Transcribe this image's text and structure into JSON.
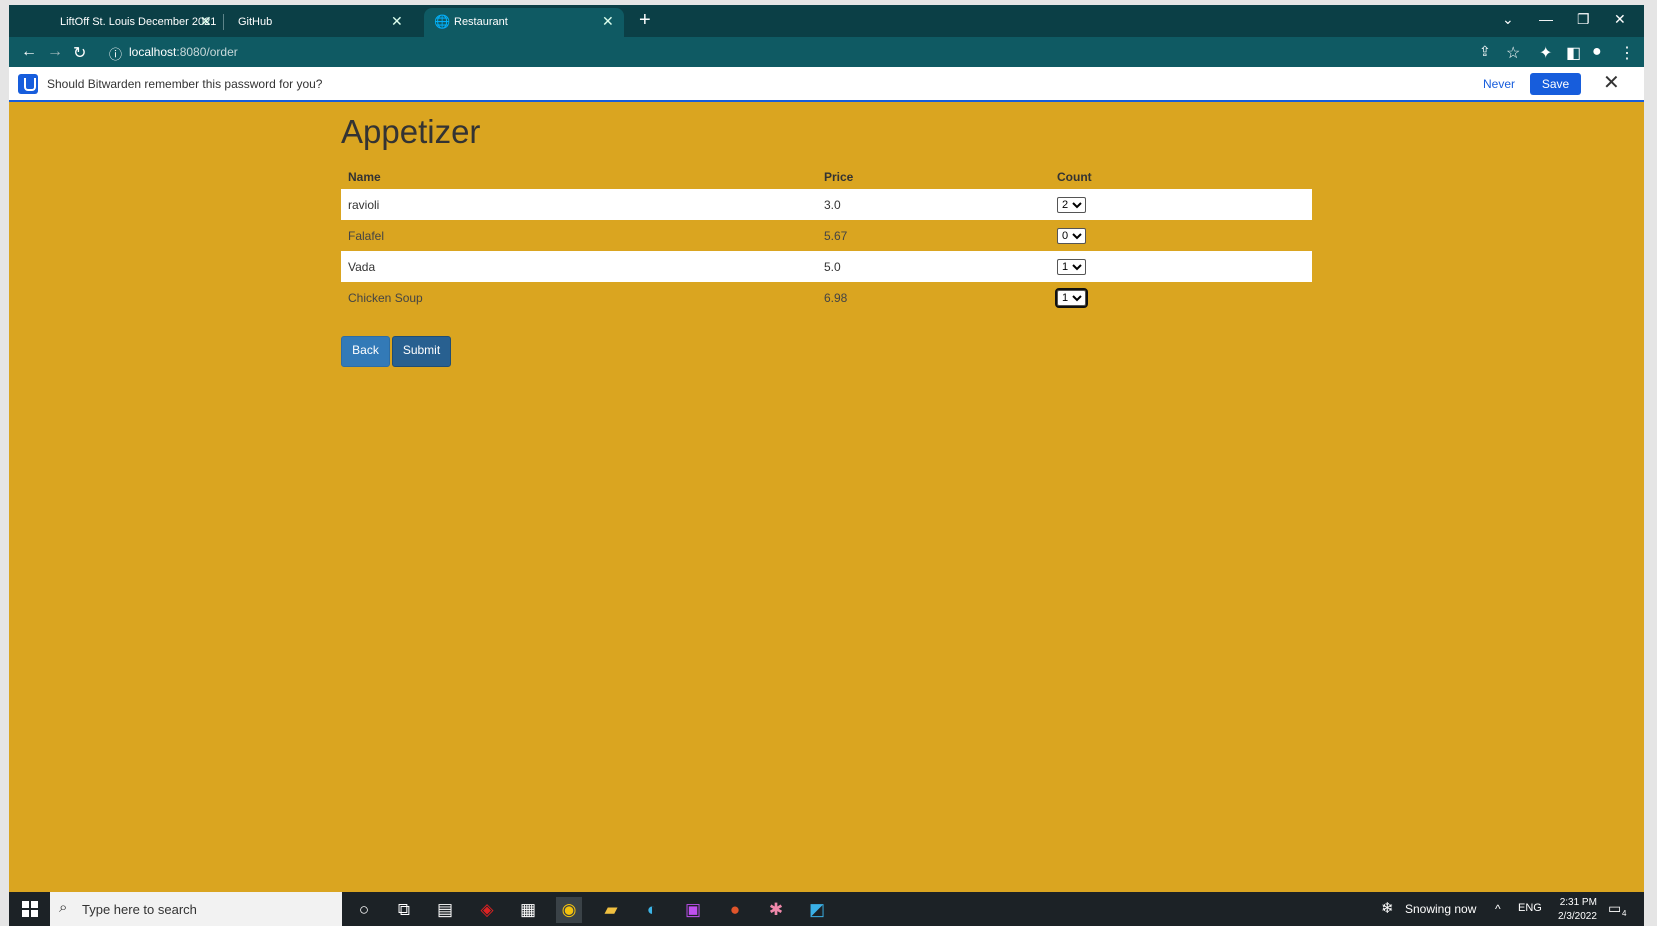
{
  "browser": {
    "tabs": [
      {
        "label": "LiftOff St. Louis December 2021",
        "icon": "page-icon"
      },
      {
        "label": "GitHub",
        "icon": "github-icon"
      },
      {
        "label": "Restaurant",
        "icon": "globe-icon",
        "active": true
      }
    ],
    "url_host": "localhost",
    "url_path": ":8080/order"
  },
  "bitwarden": {
    "prompt": "Should Bitwarden remember this password for you?",
    "never_label": "Never",
    "save_label": "Save"
  },
  "page": {
    "heading": "Appetizer",
    "columns": {
      "name": "Name",
      "price": "Price",
      "count": "Count"
    },
    "items": [
      {
        "name": "ravioli",
        "price": "3.0",
        "count": "2"
      },
      {
        "name": "Falafel",
        "price": "5.67",
        "count": "0"
      },
      {
        "name": "Vada",
        "price": "5.0",
        "count": "1"
      },
      {
        "name": "Chicken Soup",
        "price": "6.98",
        "count": "1"
      }
    ],
    "back_label": "Back",
    "submit_label": "Submit"
  },
  "taskbar": {
    "search_placeholder": "Type here to search",
    "weather": "Snowing now",
    "lang": "ENG",
    "time": "2:31 PM",
    "date": "2/3/2022",
    "notification_count": "4"
  },
  "colors": {
    "page_bg": "#daa520",
    "tab_bg": "#0b3f46",
    "toolbar_bg": "#0f5a63",
    "bitwarden_blue": "#175ddc",
    "button_blue": "#337ab7"
  }
}
